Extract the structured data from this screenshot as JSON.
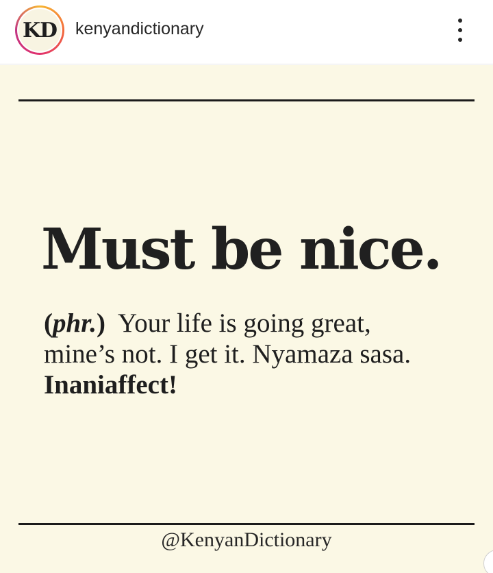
{
  "header": {
    "avatar_text": "KD",
    "username": "kenyandictionary",
    "more_icon": "more-vertical-icon"
  },
  "post": {
    "headword": "Must be nice.",
    "pos_open": "(",
    "pos_abbr": "phr.",
    "pos_close": ")",
    "definition_line1": "Your life is going great,",
    "definition_line2": "mine’s not. I get it. Nyamaza sasa.",
    "definition_closing": "Inaniaffect!",
    "handle": "@KenyanDictionary"
  },
  "colors": {
    "post_background": "#fbf8e5",
    "text": "#1e1e1e",
    "rule": "#1b1b1b",
    "avatar_ring": [
      "#f7b733",
      "#f36a3a",
      "#e1306c",
      "#c13584"
    ]
  }
}
